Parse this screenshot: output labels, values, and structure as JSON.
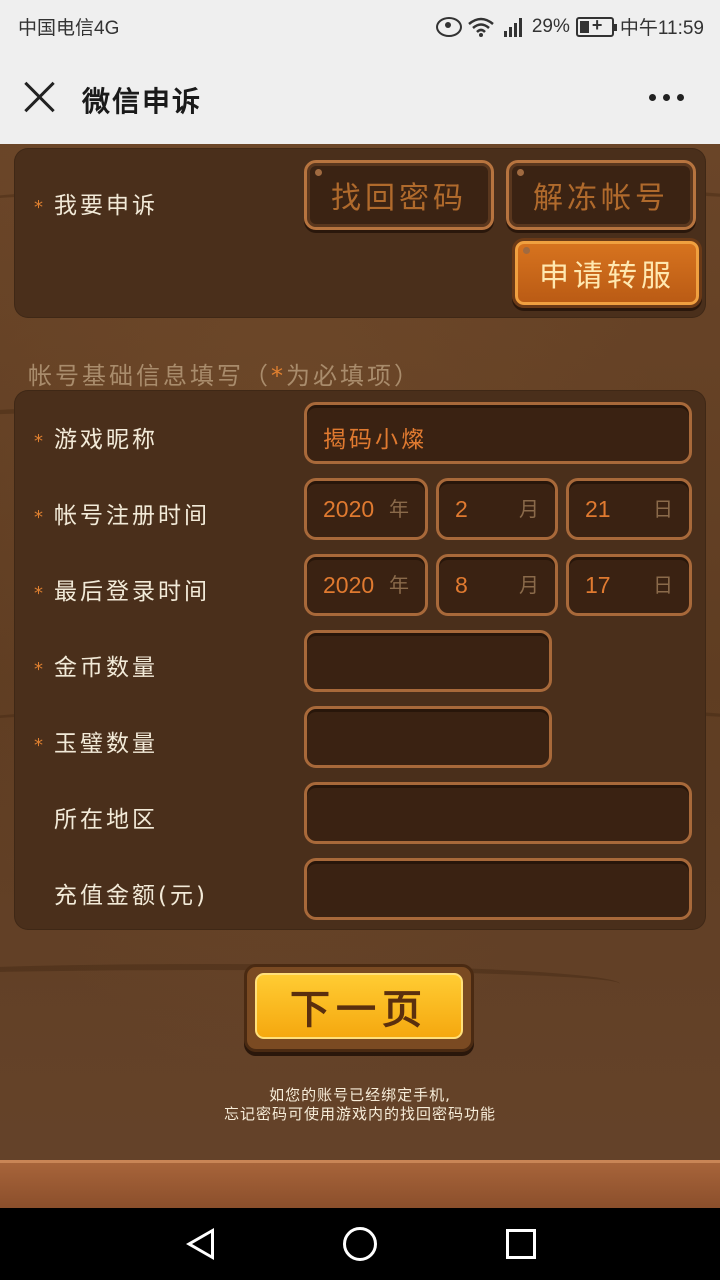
{
  "status_bar": {
    "carrier": "中国电信4G",
    "network": "4G",
    "battery": "29%",
    "time": "中午11:59"
  },
  "header": {
    "title": "微信申诉",
    "close_icon": "close-icon",
    "more_icon": "more-icon"
  },
  "appeal": {
    "label": "我要申诉",
    "options": [
      {
        "label": "找回密码",
        "selected": false
      },
      {
        "label": "解冻帐号",
        "selected": false
      },
      {
        "label": "申请转服",
        "selected": true
      }
    ]
  },
  "section": {
    "title_prefix": "帐号基础信息填写（",
    "star": "*",
    "title_suffix": "为必填项）"
  },
  "form": {
    "nickname": {
      "label": "游戏昵称",
      "value": "揭码小燦"
    },
    "register_time": {
      "label": "帐号注册时间",
      "year": "2020",
      "year_unit": "年",
      "month": "2",
      "month_unit": "月",
      "day": "21",
      "day_unit": "日"
    },
    "last_login": {
      "label": "最后登录时间",
      "year": "2020",
      "year_unit": "年",
      "month": "8",
      "month_unit": "月",
      "day": "17",
      "day_unit": "日"
    },
    "gold": {
      "label": "金币数量",
      "value": ""
    },
    "jade": {
      "label": "玉璧数量",
      "value": ""
    },
    "region": {
      "label": "所在地区",
      "value": ""
    },
    "recharge": {
      "label": "充值金额(元)",
      "value": ""
    }
  },
  "next_button": "下一页",
  "hint": {
    "line1": "如您的账号已经绑定手机,",
    "line2": "忘记密码可使用游戏内的找回密码功能"
  },
  "colors": {
    "accent": "#e07a30",
    "wood_dark": "#4a2f1b",
    "button_yellow": "#f5a80f"
  }
}
